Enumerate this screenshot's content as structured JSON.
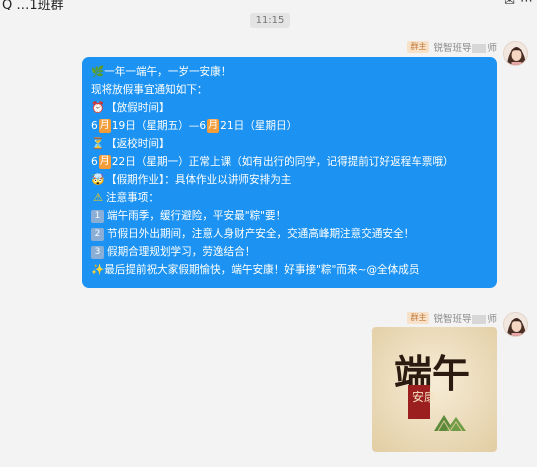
{
  "header": {
    "title": "Q …1班群",
    "window_icons": [
      "mail-icon",
      "more-icon"
    ]
  },
  "timestamp": "11:15",
  "messages": [
    {
      "sender_badge": "群主",
      "sender_name_prefix": "锐智班导",
      "sender_name_suffix": "师",
      "lines": [
        "🌿一年一端午，一岁一安康！",
        "现将放假事宜通知如下：",
        "【放假时间】",
        "6",
        "19日（星期五）—6",
        "21日（星期日）",
        "【返校时间】",
        "6",
        "22日（星期一）正常上课（如有出行的同学，记得提前订好返程车票哦）",
        "【假期作业】：具体作业以讲师安排为主",
        "注意事项：",
        "端午雨季，缓行避险，平安最\"粽\"要！",
        "节假日外出期间，注意人身财产安全，交通高峰期注意交通安全！",
        "假期合理规划学习，劳逸结合！",
        "✨最后提前祝大家假期愉快，端午安康！好事接\"粽\"而来~@全体成员"
      ],
      "month_label": "月",
      "numbers": [
        "1",
        "2",
        "3"
      ]
    },
    {
      "sender_badge": "群主",
      "sender_name_prefix": "锐智班导",
      "sender_name_suffix": "师",
      "sticker": {
        "text_main": "端午",
        "text_seal": "安康"
      }
    }
  ],
  "colors": {
    "bubble": "#1c93f2",
    "badge_bg": "#f7e1c8",
    "badge_text": "#c27a3a",
    "month_highlight": "#f39c3a"
  }
}
